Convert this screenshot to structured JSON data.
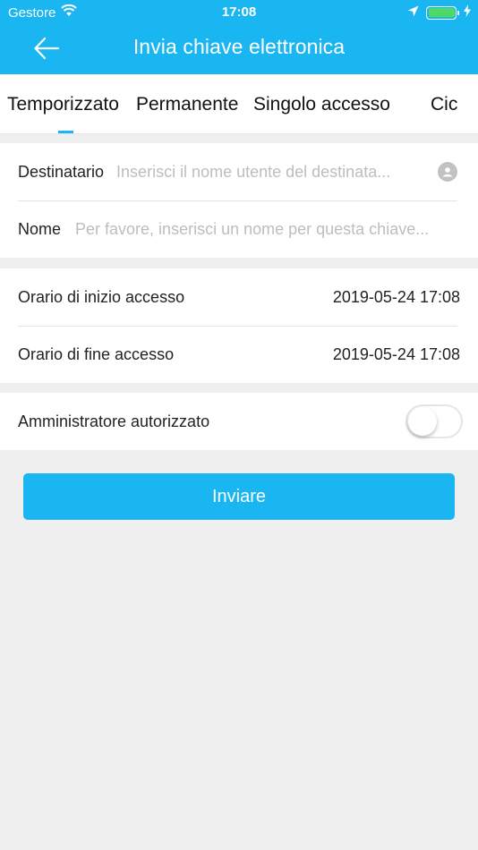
{
  "status_bar": {
    "carrier": "Gestore",
    "time": "17:08",
    "battery_color": "#4cd964"
  },
  "header": {
    "title": "Invia chiave elettronica",
    "back_icon": "arrow-left-icon",
    "background_color": "#1ab6f2"
  },
  "tabs": {
    "items": [
      "Temporizzato",
      "Permanente",
      "Singolo accesso",
      "Cic"
    ],
    "selected_index": 0
  },
  "recipient": {
    "label": "Destinatario",
    "placeholder": "Inserisci il nome utente del destinata...",
    "icon": "contact-icon"
  },
  "name": {
    "label": "Nome",
    "placeholder": "Per favore, inserisci un nome per questa chiave..."
  },
  "access": {
    "start_label": "Orario di inizio accesso",
    "start_value": "2019-05-24 17:08",
    "end_label": "Orario di fine accesso",
    "end_value": "2019-05-24 17:08"
  },
  "admin": {
    "label": "Amministratore autorizzato",
    "enabled": false
  },
  "send_button": {
    "label": "Inviare"
  }
}
